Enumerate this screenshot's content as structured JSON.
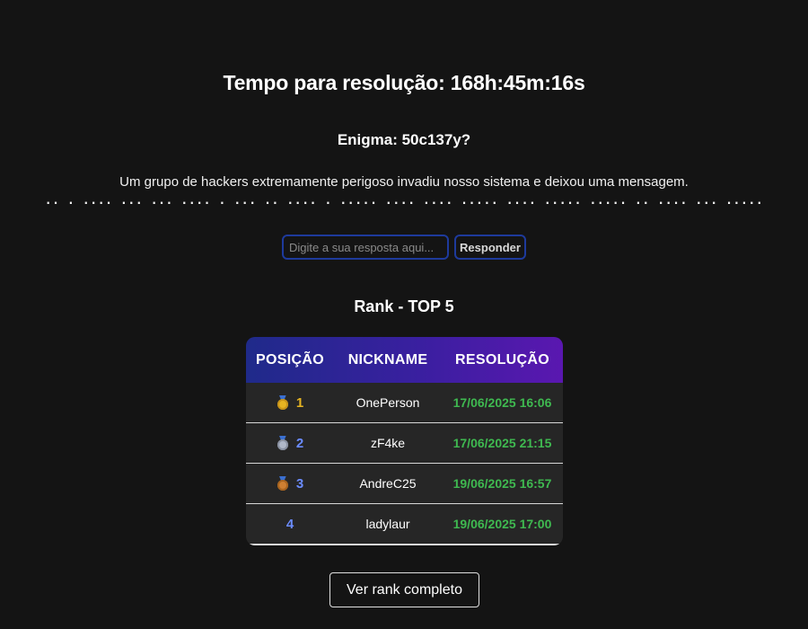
{
  "challenge": {
    "timer_text": "Tempo para resolução: 168h:45m:16s",
    "enigma_title": "Enigma: 50c137y?",
    "description": "Um grupo de hackers extremamente perigoso invadiu nosso sistema e deixou uma mensagem.",
    "morse": ".. . .... ... ... .... . ... .. .... . ..... .... .... ..... .... ..... ..... .. .... ... ....."
  },
  "answer": {
    "placeholder": "Digite a sua resposta aqui...",
    "value": "",
    "submit_label": "Responder"
  },
  "rank": {
    "title": "Rank - TOP 5",
    "headers": [
      "POSIÇÃO",
      "NICKNAME",
      "RESOLUÇÃO"
    ],
    "rows": [
      {
        "medal": "gold-medal-icon",
        "position": "1",
        "nickname": "OnePerson",
        "resolution": "17/06/2025 16:06"
      },
      {
        "medal": "silver-medal-icon",
        "position": "2",
        "nickname": "zF4ke",
        "resolution": "17/06/2025 21:15"
      },
      {
        "medal": "bronze-medal-icon",
        "position": "3",
        "nickname": "AndreC25",
        "resolution": "19/06/2025 16:57"
      },
      {
        "medal": "",
        "position": "4",
        "nickname": "ladylaur",
        "resolution": "19/06/2025 17:00"
      }
    ],
    "full_rank_label": "Ver rank completo"
  },
  "colors": {
    "background": "#141414",
    "header_gradient_start": "#1f2a8a",
    "header_gradient_end": "#5a17b0",
    "input_border": "#1e3a9c",
    "date_green": "#3fb950",
    "gold": "#e6b422",
    "silver": "#b0b8c8",
    "bronze": "#cd7f32",
    "position_blue": "#6b8cff"
  }
}
